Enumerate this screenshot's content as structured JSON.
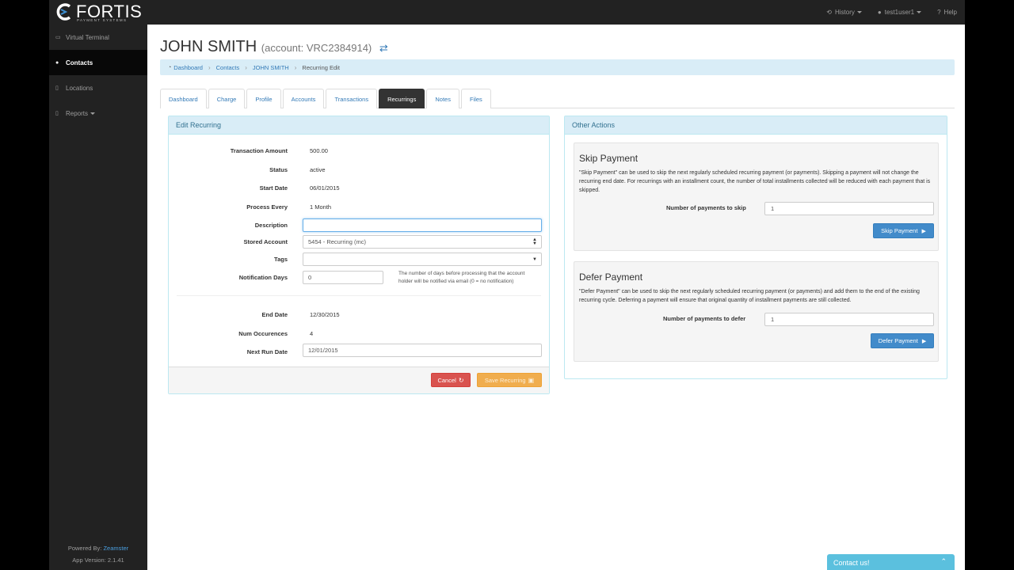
{
  "brand": {
    "name": "FORTIS",
    "tagline": "PAYMENT SYSTEMS"
  },
  "topnav": {
    "history": "History",
    "user": "test1user1",
    "help": "Help"
  },
  "sidebar": {
    "items": [
      {
        "label": "Virtual Terminal",
        "icon": "credit-card-icon"
      },
      {
        "label": "Contacts",
        "icon": "users-icon"
      },
      {
        "label": "Locations",
        "icon": "building-icon"
      },
      {
        "label": "Reports",
        "icon": "file-icon"
      }
    ],
    "powered_prefix": "Powered By:",
    "powered_by": "Zeamster",
    "app_version": "App Version: 2.1.41"
  },
  "page": {
    "name": "JOHN SMITH",
    "account": "(account: VRC2384914)"
  },
  "breadcrumb": {
    "dashboard": "Dashboard",
    "contacts": "Contacts",
    "contact": "JOHN SMITH",
    "current": "Recurring Edit"
  },
  "tabs": [
    "Dashboard",
    "Charge",
    "Profile",
    "Accounts",
    "Transactions",
    "Recurrings",
    "Notes",
    "Files"
  ],
  "active_tab": "Recurrings",
  "edit": {
    "title": "Edit Recurring",
    "amount_label": "Transaction Amount",
    "amount": "500.00",
    "status_label": "Status",
    "status": "active",
    "start_label": "Start Date",
    "start": "06/01/2015",
    "process_label": "Process Every",
    "process": "1 Month",
    "description_label": "Description",
    "description": "",
    "stored_label": "Stored Account",
    "stored": "5454 - Recurring (mc)",
    "tags_label": "Tags",
    "tags": "",
    "notif_label": "Notification Days",
    "notif": "0",
    "notif_help": "The number of days before processing that the account holder will be notified via email (0 = no notification)",
    "end_label": "End Date",
    "end": "12/30/2015",
    "num_label": "Num Occurences",
    "num": "4",
    "next_label": "Next Run Date",
    "next": "12/01/2015",
    "cancel": "Cancel",
    "save": "Save Recurring"
  },
  "other": {
    "title": "Other Actions",
    "skip": {
      "title": "Skip Payment",
      "desc": "\"Skip Payment\" can be used to skip the next regularly scheduled recurring payment (or payments). Skipping a payment will not change the recurring end date. For recurrings with an installment count, the number of total installments collected will be reduced with each payment that is skipped.",
      "label": "Number of payments to skip",
      "value": "1",
      "button": "Skip Payment"
    },
    "defer": {
      "title": "Defer Payment",
      "desc": "\"Defer Payment\" can be used to skip the next regularly scheduled recurring payment (or payments) and add them to the end of the existing recurring cycle. Deferring a payment will ensure that original quantity of installment payments are still collected.",
      "label": "Number of payments to defer",
      "value": "1",
      "button": "Defer Payment"
    }
  },
  "contact_us": "Contact us!"
}
